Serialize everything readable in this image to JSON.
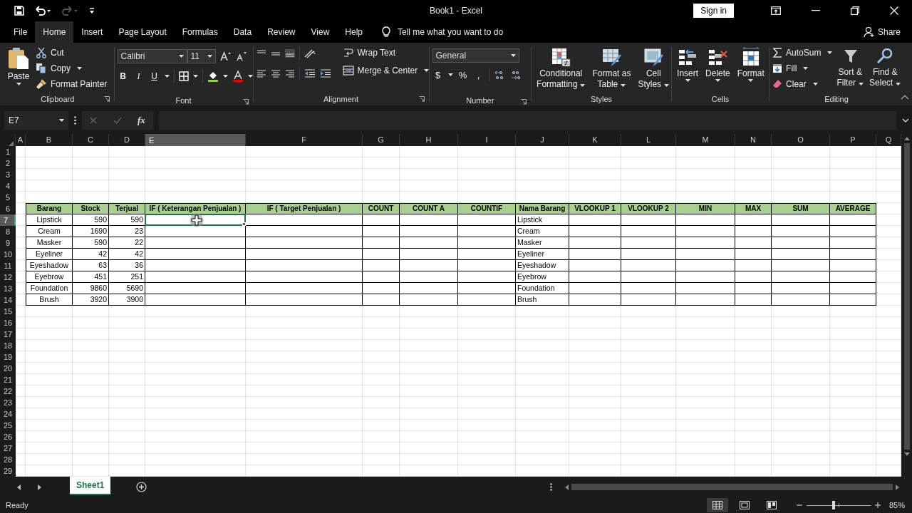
{
  "title_bar": {
    "title": "Book1  -  Excel",
    "sign_in": "Sign in"
  },
  "menu": [
    {
      "label": "File",
      "selected": false
    },
    {
      "label": "Home",
      "selected": true
    },
    {
      "label": "Insert",
      "selected": false
    },
    {
      "label": "Page Layout",
      "selected": false
    },
    {
      "label": "Formulas",
      "selected": false
    },
    {
      "label": "Data",
      "selected": false
    },
    {
      "label": "Review",
      "selected": false
    },
    {
      "label": "View",
      "selected": false
    },
    {
      "label": "Help",
      "selected": false
    }
  ],
  "tell_me": "Tell me what you want to do",
  "share": "Share",
  "ribbon": {
    "clipboard": {
      "label": "Clipboard",
      "paste": "Paste",
      "cut": "Cut",
      "copy": "Copy",
      "format_painter": "Format Painter"
    },
    "font": {
      "label": "Font",
      "name": "Calibri",
      "size": "11",
      "bold": "B",
      "italic": "I",
      "underline": "U"
    },
    "alignment": {
      "label": "Alignment",
      "wrap_text": "Wrap Text",
      "merge_center": "Merge & Center"
    },
    "number": {
      "label": "Number",
      "format": "General",
      "currency": "$",
      "percent": "%",
      "comma": ","
    },
    "styles": {
      "label": "Styles",
      "buttons": [
        {
          "kind": "conditional",
          "lines": [
            "Conditional",
            "Formatting"
          ]
        },
        {
          "kind": "table",
          "lines": [
            "Format as",
            "Table"
          ]
        },
        {
          "kind": "styles",
          "lines": [
            "Cell",
            "Styles"
          ]
        }
      ]
    },
    "cells": {
      "label": "Cells",
      "buttons": [
        {
          "kind": "insert",
          "label": "Insert"
        },
        {
          "kind": "delete",
          "label": "Delete"
        },
        {
          "kind": "format",
          "label": "Format"
        }
      ]
    },
    "editing": {
      "label": "Editing",
      "autosum": "AutoSum",
      "fill": "Fill",
      "clear": "Clear",
      "buttons": [
        {
          "kind": "sort",
          "lines": [
            "Sort &",
            "Filter"
          ]
        },
        {
          "kind": "find",
          "lines": [
            "Find &",
            "Select"
          ]
        }
      ]
    }
  },
  "formula_bar": {
    "name_box": "E7",
    "fx": "fx"
  },
  "sheet": {
    "columns": [
      {
        "label": "A",
        "selected": false
      },
      {
        "label": "B",
        "selected": false
      },
      {
        "label": "C",
        "selected": false
      },
      {
        "label": "D",
        "selected": false
      },
      {
        "label": "E",
        "selected": true
      },
      {
        "label": "F",
        "selected": false
      },
      {
        "label": "G",
        "selected": false
      },
      {
        "label": "H",
        "selected": false
      },
      {
        "label": "I",
        "selected": false
      },
      {
        "label": "J",
        "selected": false
      },
      {
        "label": "K",
        "selected": false
      },
      {
        "label": "L",
        "selected": false
      },
      {
        "label": "M",
        "selected": false
      },
      {
        "label": "N",
        "selected": false
      },
      {
        "label": "O",
        "selected": false
      },
      {
        "label": "P",
        "selected": false
      },
      {
        "label": "Q",
        "selected": false
      }
    ],
    "rows": [
      {
        "label": "1",
        "selected": false
      },
      {
        "label": "2",
        "selected": false
      },
      {
        "label": "3",
        "selected": false
      },
      {
        "label": "4",
        "selected": false
      },
      {
        "label": "5",
        "selected": false
      },
      {
        "label": "6",
        "selected": false
      },
      {
        "label": "7",
        "selected": true
      },
      {
        "label": "8",
        "selected": false
      },
      {
        "label": "9",
        "selected": false
      },
      {
        "label": "10",
        "selected": false
      },
      {
        "label": "11",
        "selected": false
      },
      {
        "label": "12",
        "selected": false
      },
      {
        "label": "13",
        "selected": false
      },
      {
        "label": "14",
        "selected": false
      },
      {
        "label": "15",
        "selected": false
      },
      {
        "label": "16",
        "selected": false
      },
      {
        "label": "17",
        "selected": false
      },
      {
        "label": "18",
        "selected": false
      },
      {
        "label": "19",
        "selected": false
      },
      {
        "label": "20",
        "selected": false
      },
      {
        "label": "21",
        "selected": false
      },
      {
        "label": "22",
        "selected": false
      },
      {
        "label": "23",
        "selected": false
      },
      {
        "label": "24",
        "selected": false
      },
      {
        "label": "25",
        "selected": false
      },
      {
        "label": "26",
        "selected": false
      },
      {
        "label": "27",
        "selected": false
      },
      {
        "label": "28",
        "selected": false
      },
      {
        "label": "29",
        "selected": false
      }
    ],
    "table": {
      "headers": [
        "Barang",
        "Stock",
        "Terjual",
        "IF ( Keterangan Penjualan )",
        "IF ( Target Penjualan )",
        "COUNT",
        "COUNT A",
        "COUNTIF",
        "Nama Barang",
        "VLOOKUP 1",
        "VLOOKUP 2",
        "MIN",
        "MAX",
        "SUM",
        "AVERAGE"
      ],
      "rows": [
        {
          "barang": "Lipstick",
          "stock": "590",
          "terjual": "590",
          "nama_barang": "Lipstick"
        },
        {
          "barang": "Cream",
          "stock": "1690",
          "terjual": "23",
          "nama_barang": "Cream"
        },
        {
          "barang": "Masker",
          "stock": "590",
          "terjual": "22",
          "nama_barang": "Masker"
        },
        {
          "barang": "Eyeliner",
          "stock": "42",
          "terjual": "42",
          "nama_barang": "Eyeliner"
        },
        {
          "barang": "Eyeshadow",
          "stock": "63",
          "terjual": "36",
          "nama_barang": "Eyeshadow"
        },
        {
          "barang": "Eyebrow",
          "stock": "451",
          "terjual": "251",
          "nama_barang": "Eyebrow"
        },
        {
          "barang": "Foundation",
          "stock": "9860",
          "terjual": "5690",
          "nama_barang": "Foundation"
        },
        {
          "barang": "Brush",
          "stock": "3920",
          "terjual": "3900",
          "nama_barang": "Brush"
        }
      ]
    }
  },
  "sheet_tabs": [
    {
      "label": "Sheet1",
      "selected": true
    }
  ],
  "status_bar": {
    "status": "Ready",
    "zoom": "85%",
    "zoom_slider": {
      "level": 0.42
    }
  }
}
